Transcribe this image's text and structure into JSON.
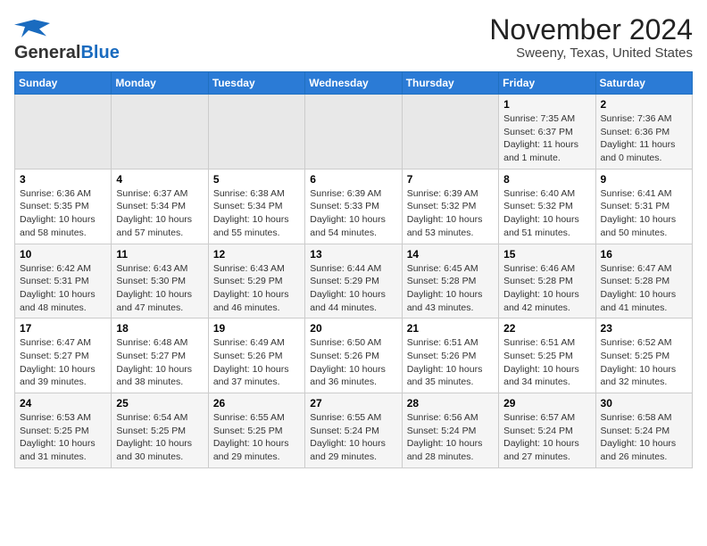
{
  "header": {
    "logo_general": "General",
    "logo_blue": "Blue",
    "title": "November 2024",
    "subtitle": "Sweeny, Texas, United States"
  },
  "weekdays": [
    "Sunday",
    "Monday",
    "Tuesday",
    "Wednesday",
    "Thursday",
    "Friday",
    "Saturday"
  ],
  "weeks": [
    [
      {
        "day": "",
        "info": ""
      },
      {
        "day": "",
        "info": ""
      },
      {
        "day": "",
        "info": ""
      },
      {
        "day": "",
        "info": ""
      },
      {
        "day": "",
        "info": ""
      },
      {
        "day": "1",
        "info": "Sunrise: 7:35 AM\nSunset: 6:37 PM\nDaylight: 11 hours\nand 1 minute."
      },
      {
        "day": "2",
        "info": "Sunrise: 7:36 AM\nSunset: 6:36 PM\nDaylight: 11 hours\nand 0 minutes."
      }
    ],
    [
      {
        "day": "3",
        "info": "Sunrise: 6:36 AM\nSunset: 5:35 PM\nDaylight: 10 hours\nand 58 minutes."
      },
      {
        "day": "4",
        "info": "Sunrise: 6:37 AM\nSunset: 5:34 PM\nDaylight: 10 hours\nand 57 minutes."
      },
      {
        "day": "5",
        "info": "Sunrise: 6:38 AM\nSunset: 5:34 PM\nDaylight: 10 hours\nand 55 minutes."
      },
      {
        "day": "6",
        "info": "Sunrise: 6:39 AM\nSunset: 5:33 PM\nDaylight: 10 hours\nand 54 minutes."
      },
      {
        "day": "7",
        "info": "Sunrise: 6:39 AM\nSunset: 5:32 PM\nDaylight: 10 hours\nand 53 minutes."
      },
      {
        "day": "8",
        "info": "Sunrise: 6:40 AM\nSunset: 5:32 PM\nDaylight: 10 hours\nand 51 minutes."
      },
      {
        "day": "9",
        "info": "Sunrise: 6:41 AM\nSunset: 5:31 PM\nDaylight: 10 hours\nand 50 minutes."
      }
    ],
    [
      {
        "day": "10",
        "info": "Sunrise: 6:42 AM\nSunset: 5:31 PM\nDaylight: 10 hours\nand 48 minutes."
      },
      {
        "day": "11",
        "info": "Sunrise: 6:43 AM\nSunset: 5:30 PM\nDaylight: 10 hours\nand 47 minutes."
      },
      {
        "day": "12",
        "info": "Sunrise: 6:43 AM\nSunset: 5:29 PM\nDaylight: 10 hours\nand 46 minutes."
      },
      {
        "day": "13",
        "info": "Sunrise: 6:44 AM\nSunset: 5:29 PM\nDaylight: 10 hours\nand 44 minutes."
      },
      {
        "day": "14",
        "info": "Sunrise: 6:45 AM\nSunset: 5:28 PM\nDaylight: 10 hours\nand 43 minutes."
      },
      {
        "day": "15",
        "info": "Sunrise: 6:46 AM\nSunset: 5:28 PM\nDaylight: 10 hours\nand 42 minutes."
      },
      {
        "day": "16",
        "info": "Sunrise: 6:47 AM\nSunset: 5:28 PM\nDaylight: 10 hours\nand 41 minutes."
      }
    ],
    [
      {
        "day": "17",
        "info": "Sunrise: 6:47 AM\nSunset: 5:27 PM\nDaylight: 10 hours\nand 39 minutes."
      },
      {
        "day": "18",
        "info": "Sunrise: 6:48 AM\nSunset: 5:27 PM\nDaylight: 10 hours\nand 38 minutes."
      },
      {
        "day": "19",
        "info": "Sunrise: 6:49 AM\nSunset: 5:26 PM\nDaylight: 10 hours\nand 37 minutes."
      },
      {
        "day": "20",
        "info": "Sunrise: 6:50 AM\nSunset: 5:26 PM\nDaylight: 10 hours\nand 36 minutes."
      },
      {
        "day": "21",
        "info": "Sunrise: 6:51 AM\nSunset: 5:26 PM\nDaylight: 10 hours\nand 35 minutes."
      },
      {
        "day": "22",
        "info": "Sunrise: 6:51 AM\nSunset: 5:25 PM\nDaylight: 10 hours\nand 34 minutes."
      },
      {
        "day": "23",
        "info": "Sunrise: 6:52 AM\nSunset: 5:25 PM\nDaylight: 10 hours\nand 32 minutes."
      }
    ],
    [
      {
        "day": "24",
        "info": "Sunrise: 6:53 AM\nSunset: 5:25 PM\nDaylight: 10 hours\nand 31 minutes."
      },
      {
        "day": "25",
        "info": "Sunrise: 6:54 AM\nSunset: 5:25 PM\nDaylight: 10 hours\nand 30 minutes."
      },
      {
        "day": "26",
        "info": "Sunrise: 6:55 AM\nSunset: 5:25 PM\nDaylight: 10 hours\nand 29 minutes."
      },
      {
        "day": "27",
        "info": "Sunrise: 6:55 AM\nSunset: 5:24 PM\nDaylight: 10 hours\nand 29 minutes."
      },
      {
        "day": "28",
        "info": "Sunrise: 6:56 AM\nSunset: 5:24 PM\nDaylight: 10 hours\nand 28 minutes."
      },
      {
        "day": "29",
        "info": "Sunrise: 6:57 AM\nSunset: 5:24 PM\nDaylight: 10 hours\nand 27 minutes."
      },
      {
        "day": "30",
        "info": "Sunrise: 6:58 AM\nSunset: 5:24 PM\nDaylight: 10 hours\nand 26 minutes."
      }
    ]
  ]
}
